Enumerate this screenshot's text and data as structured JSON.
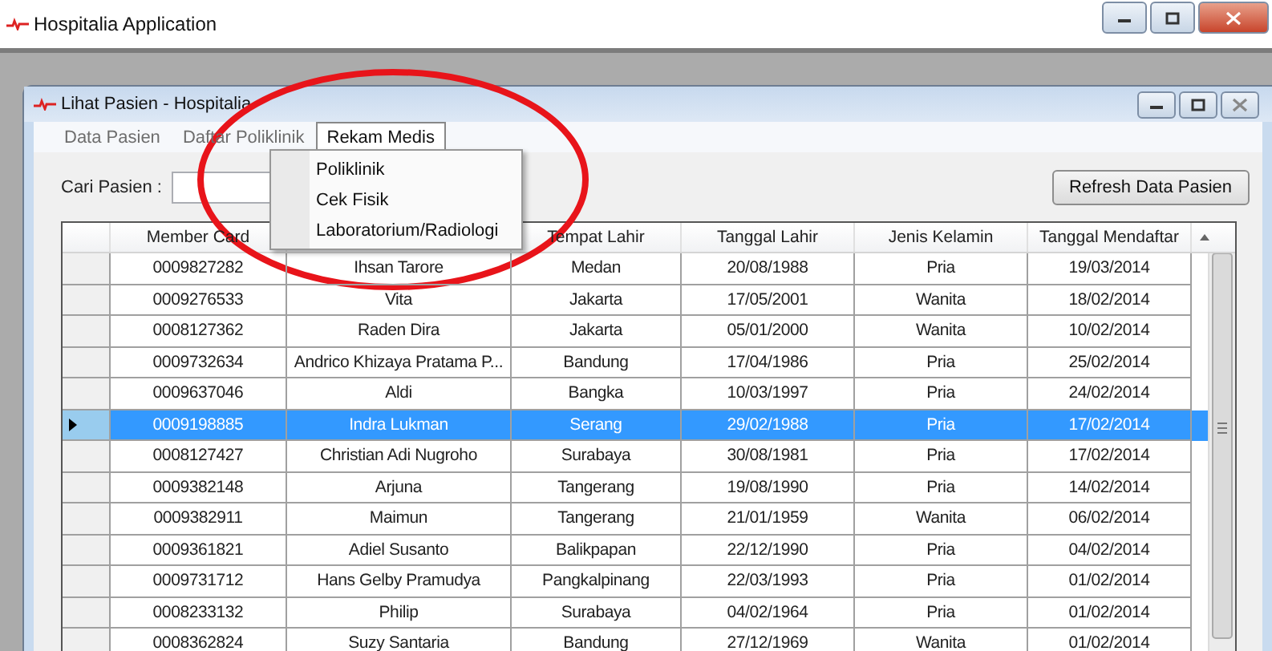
{
  "window": {
    "title": "Hospitalia Application"
  },
  "child_window": {
    "title": "Lihat Pasien - Hospitalia"
  },
  "menu": [
    {
      "label": "Data Pasien",
      "selected": false
    },
    {
      "label": "Daftar Poliklinik",
      "selected": false
    },
    {
      "label": "Rekam Medis",
      "selected": true
    }
  ],
  "dropdown": [
    {
      "label": "Poliklinik"
    },
    {
      "label": "Cek Fisik"
    },
    {
      "label": "Laboratorium/Radiologi"
    }
  ],
  "search": {
    "label": "Cari Pasien :"
  },
  "refresh_button": "Refresh Data Pasien",
  "table": {
    "columns": [
      "Member Card",
      "",
      "Tempat Lahir",
      "Tanggal Lahir",
      "Jenis Kelamin",
      "Tanggal Mendaftar"
    ],
    "rows": [
      {
        "cells": [
          "0009827282",
          "Ihsan Tarore",
          "Medan",
          "20/08/1988",
          "Pria",
          "19/03/2014"
        ],
        "selected": false
      },
      {
        "cells": [
          "0009276533",
          "Vita",
          "Jakarta",
          "17/05/2001",
          "Wanita",
          "18/02/2014"
        ],
        "selected": false
      },
      {
        "cells": [
          "0008127362",
          "Raden Dira",
          "Jakarta",
          "05/01/2000",
          "Wanita",
          "10/02/2014"
        ],
        "selected": false
      },
      {
        "cells": [
          "0009732634",
          "Andrico Khizaya Pratama P...",
          "Bandung",
          "17/04/1986",
          "Pria",
          "25/02/2014"
        ],
        "selected": false
      },
      {
        "cells": [
          "0009637046",
          "Aldi",
          "Bangka",
          "10/03/1997",
          "Pria",
          "24/02/2014"
        ],
        "selected": false
      },
      {
        "cells": [
          "0009198885",
          "Indra Lukman",
          "Serang",
          "29/02/1988",
          "Pria",
          "17/02/2014"
        ],
        "selected": true
      },
      {
        "cells": [
          "0008127427",
          "Christian Adi Nugroho",
          "Surabaya",
          "30/08/1981",
          "Pria",
          "17/02/2014"
        ],
        "selected": false
      },
      {
        "cells": [
          "0009382148",
          "Arjuna",
          "Tangerang",
          "19/08/1990",
          "Pria",
          "14/02/2014"
        ],
        "selected": false
      },
      {
        "cells": [
          "0009382911",
          "Maimun",
          "Tangerang",
          "21/01/1959",
          "Wanita",
          "06/02/2014"
        ],
        "selected": false
      },
      {
        "cells": [
          "0009361821",
          "Adiel Susanto",
          "Balikpapan",
          "22/12/1990",
          "Pria",
          "04/02/2014"
        ],
        "selected": false
      },
      {
        "cells": [
          "0009731712",
          "Hans Gelby Pramudya",
          "Pangkalpinang",
          "22/03/1993",
          "Pria",
          "01/02/2014"
        ],
        "selected": false
      },
      {
        "cells": [
          "0008233132",
          "Philip",
          "Surabaya",
          "04/02/1964",
          "Pria",
          "01/02/2014"
        ],
        "selected": false
      },
      {
        "cells": [
          "0008362824",
          "Suzy Santaria",
          "Bandung",
          "27/12/1969",
          "Wanita",
          "01/02/2014"
        ],
        "selected": false
      }
    ]
  }
}
